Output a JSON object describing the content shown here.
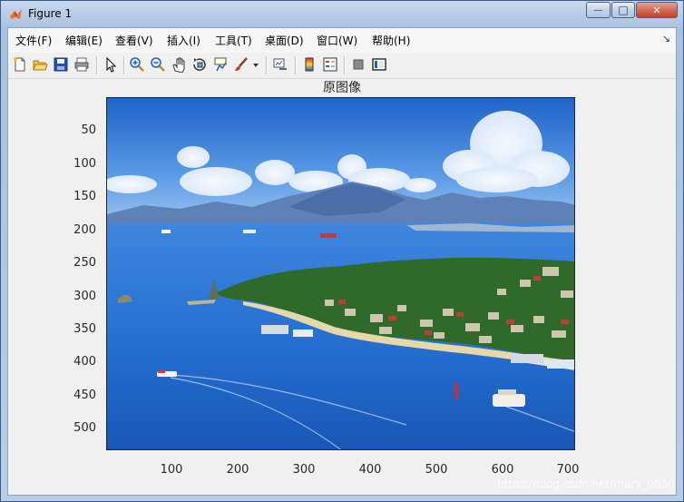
{
  "window": {
    "title": "Figure 1",
    "min_label": "—",
    "max_label": "□",
    "close_label": "✕"
  },
  "menu": {
    "items": [
      "文件(F)",
      "编辑(E)",
      "查看(V)",
      "插入(I)",
      "工具(T)",
      "桌面(D)",
      "窗口(W)",
      "帮助(H)"
    ],
    "corner": "↘"
  },
  "toolbar": {
    "icons": [
      "new-figure-icon",
      "open-file-icon",
      "save-icon",
      "print-icon",
      "pointer-icon",
      "zoom-in-icon",
      "zoom-out-icon",
      "pan-icon",
      "rotate-3d-icon",
      "data-cursor-icon",
      "brush-icon",
      "brush-dropdown-icon",
      "link-plot-icon",
      "colorbar-icon",
      "legend-icon",
      "hide-plot-tools-icon",
      "show-plot-tools-icon"
    ]
  },
  "axes": {
    "title": "原图像",
    "yticks": [
      "50",
      "100",
      "150",
      "200",
      "250",
      "300",
      "350",
      "400",
      "450",
      "500"
    ],
    "xticks": [
      "100",
      "200",
      "300",
      "400",
      "500",
      "600",
      "700"
    ]
  },
  "watermark": "https://blog.csdn.net/mary_0830",
  "colors": {
    "sky": "#3a7fd6",
    "sea": "#1f6bd0",
    "cloud": "#ffffff",
    "mountain": "#5b7fb4",
    "land": "#2f6a2a"
  }
}
